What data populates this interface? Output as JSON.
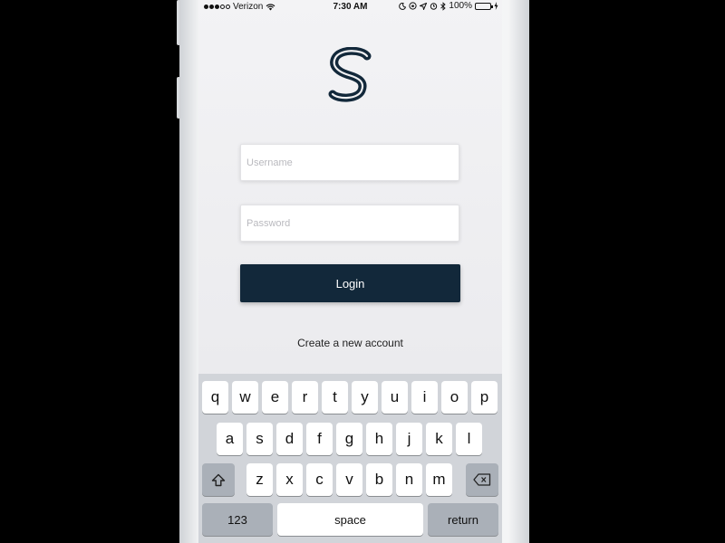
{
  "status_bar": {
    "carrier": "Verizon",
    "time": "7:30 AM",
    "battery_percent": "100%",
    "battery_level": 1.0,
    "battery_color": "#3cc14a"
  },
  "app": {
    "logo_letter": "S",
    "brand_color": "#12283a"
  },
  "login_form": {
    "username_placeholder": "Username",
    "password_placeholder": "Password",
    "login_label": "Login",
    "create_account_label": "Create a new account"
  },
  "keyboard": {
    "row1": [
      "q",
      "w",
      "e",
      "r",
      "t",
      "y",
      "u",
      "i",
      "o",
      "p"
    ],
    "row2": [
      "a",
      "s",
      "d",
      "f",
      "g",
      "h",
      "j",
      "k",
      "l"
    ],
    "row3": [
      "z",
      "x",
      "c",
      "v",
      "b",
      "n",
      "m"
    ],
    "shift_icon": "shift-icon",
    "delete_icon": "delete-icon",
    "numbers_label": "123",
    "space_label": "space",
    "return_label": "return"
  }
}
